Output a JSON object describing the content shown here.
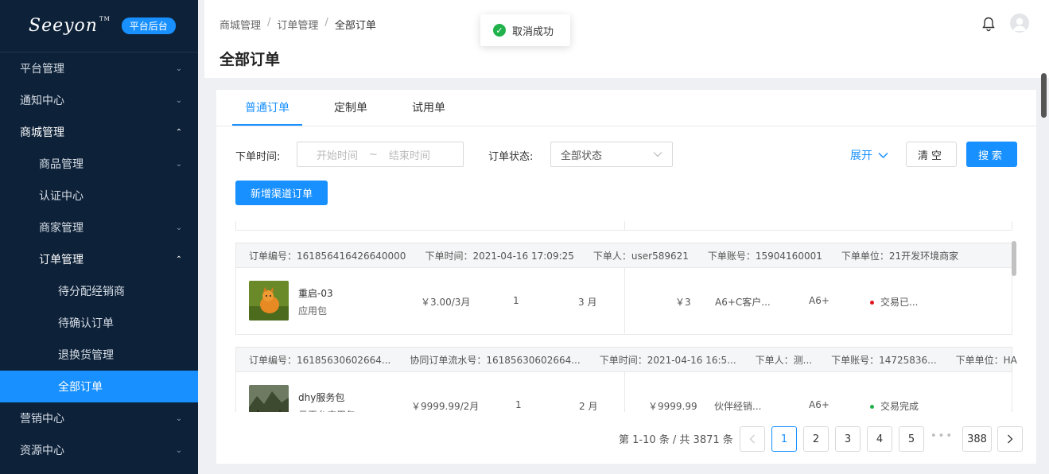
{
  "sidebar": {
    "logo": "Seeyon",
    "logo_tm": "TM",
    "badge": "平台后台",
    "items": [
      {
        "label": "平台管理"
      },
      {
        "label": "通知中心"
      },
      {
        "label": "商城管理"
      },
      {
        "label": "商品管理"
      },
      {
        "label": "认证中心"
      },
      {
        "label": "商家管理"
      },
      {
        "label": "订单管理"
      },
      {
        "label": "待分配经销商"
      },
      {
        "label": "待确认订单"
      },
      {
        "label": "退换货管理"
      },
      {
        "label": "全部订单"
      },
      {
        "label": "营销中心"
      },
      {
        "label": "资源中心"
      }
    ]
  },
  "header": {
    "breadcrumb": [
      "商城管理",
      "订单管理",
      "全部订单"
    ],
    "breadcrumb_sep": "/",
    "title": "全部订单",
    "bell_icon": "bell-icon",
    "avatar_icon": "user-avatar-icon"
  },
  "toast": {
    "text": "取消成功",
    "icon": "check-circle-icon"
  },
  "tabs": [
    {
      "label": "普通订单",
      "active": true
    },
    {
      "label": "定制单"
    },
    {
      "label": "试用单"
    }
  ],
  "filters": {
    "order_time_label": "下单时间:",
    "start_placeholder": "开始时间",
    "range_sep": "~",
    "end_placeholder": "结束时间",
    "status_label": "订单状态:",
    "status_value": "全部状态",
    "expand_label": "展开",
    "clear_label": "清空",
    "search_label": "搜索"
  },
  "add_button": "新增渠道订单",
  "orders": [
    {
      "head": [
        "订单编号：161856416426640000",
        "下单时间：2021-04-16 17:09:25",
        "下单人：user589621",
        "下单账号：15904160001",
        "下单单位：21开发环境商家"
      ],
      "product": "重启-03",
      "type": "应用包",
      "price": "￥3.00/3月",
      "qty": "1",
      "period": "3 月",
      "amount": "￥3",
      "customer": "A6+C客户...",
      "edition": "A6+",
      "status": "交易已...",
      "status_color": "#e0161e"
    },
    {
      "head": [
        "订单编号：16185630602664...",
        "协同订单流水号：16185630602664...",
        "下单时间：2021-04-16 16:5...",
        "下单人：测...",
        "下单账号：14725836...",
        "下单单位：HAPPY..."
      ],
      "product": "dhy服务包",
      "type": "云平台应用包",
      "price": "￥9999.99/2月",
      "qty": "1",
      "period": "2 月",
      "amount": "￥9999.99",
      "customer": "伙伴经销...",
      "edition": "A6+",
      "status": "交易完成",
      "status_color": "#21b24b"
    }
  ],
  "pagination": {
    "total": "第 1-10 条 / 共 3871 条",
    "pages": [
      "1",
      "2",
      "3",
      "4",
      "5"
    ],
    "ellipsis": "•••",
    "last": "388",
    "current": "1"
  },
  "colors": {
    "primary": "#1890ff",
    "sidebar_bg": "#0d2138",
    "success": "#21b24b",
    "danger": "#e0161e"
  }
}
